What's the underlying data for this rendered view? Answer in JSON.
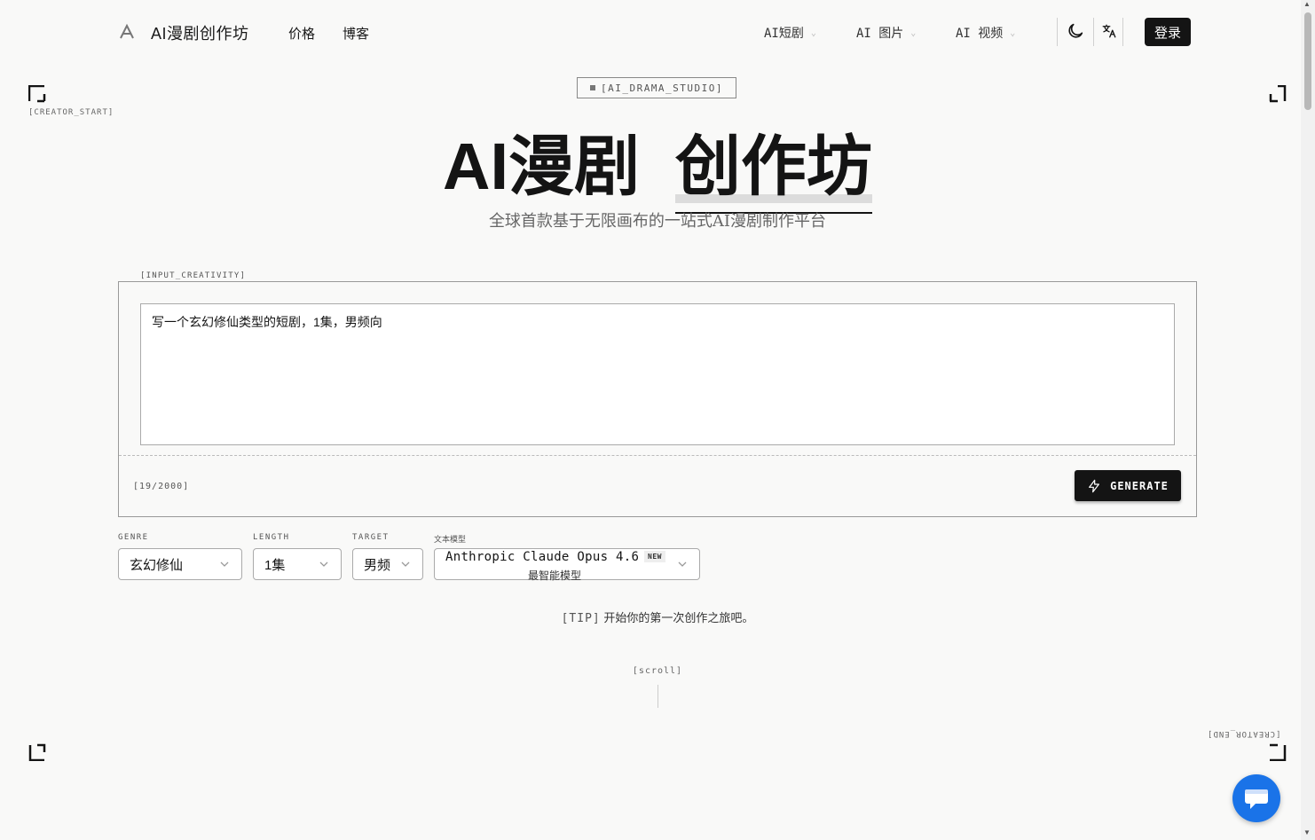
{
  "header": {
    "brand": "AI漫剧创作坊",
    "nav": [
      "价格",
      "博客"
    ],
    "menus": [
      "AI短剧",
      "AI 图片",
      "AI 视频"
    ],
    "login_label": "登录"
  },
  "corners": {
    "top_left_label": "[CREATOR_START]",
    "bottom_right_label": "[CREATOR_END]"
  },
  "hero": {
    "badge": "[AI_DRAMA_STUDIO]",
    "title_part1": "AI漫剧",
    "title_part2": "创作坊",
    "subtitle": "全球首款基于无限画布的一站式AI漫剧制作平台"
  },
  "input": {
    "section_label": "[INPUT_CREATIVITY]",
    "value": "写一个玄幻修仙类型的短剧，1集，男频向",
    "counter": "[19/2000]",
    "generate_label": "GENERATE"
  },
  "options": {
    "genre": {
      "label": "GENRE",
      "value": "玄幻修仙"
    },
    "length": {
      "label": "LENGTH",
      "value": "1集"
    },
    "target": {
      "label": "TARGET",
      "value": "男频"
    },
    "model": {
      "label": "文本模型",
      "value": "Anthropic Claude Opus 4.6",
      "badge": "NEW",
      "subtitle": "最智能模型"
    }
  },
  "tip": {
    "prefix": "[TIP]",
    "text": "开始你的第一次创作之旅吧。"
  },
  "scroll_label": "[scroll]",
  "colors": {
    "background": "#f9f9f8",
    "primary": "#141414",
    "chat_fab": "#1a73e8"
  }
}
